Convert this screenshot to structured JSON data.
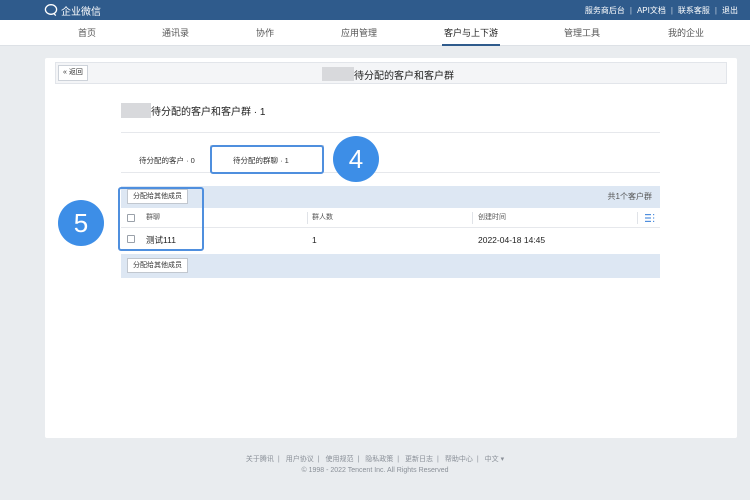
{
  "app": {
    "name": "企业微信"
  },
  "top_links": [
    "服务商后台",
    "API文档",
    "联系客服",
    "退出"
  ],
  "nav": {
    "items": [
      "首页",
      "通讯录",
      "协作",
      "应用管理",
      "客户与上下游",
      "管理工具",
      "我的企业"
    ],
    "active_index": 4
  },
  "header": {
    "back_label": "返回",
    "title": "待分配的客户和客户群"
  },
  "section": {
    "title": "待分配的客户和客户群 · 1"
  },
  "tabs": [
    {
      "label": "待分配的客户 · 0"
    },
    {
      "label": "待分配的群聊 · 1"
    }
  ],
  "toolbar": {
    "assign_label": "分配给其他成员",
    "count_label": "共1个客户群"
  },
  "table": {
    "columns": [
      "群聊",
      "群人数",
      "创建时间"
    ],
    "rows": [
      {
        "name": "测试111",
        "members": "1",
        "created": "2022-04-18 14:45"
      }
    ]
  },
  "callouts": [
    "4",
    "5"
  ],
  "footer": {
    "links": [
      "关于腾讯",
      "用户协议",
      "使用规范",
      "隐私政策",
      "更新日志",
      "帮助中心"
    ],
    "language": "中文",
    "copyright": "© 1998 - 2022 Tencent Inc. All Rights Reserved"
  },
  "colors": {
    "topbar": "#2f5b8c",
    "highlight": "#4f8fde",
    "callout_circle": "#3d8ee7",
    "toolbar_bg": "#dde7f3"
  }
}
